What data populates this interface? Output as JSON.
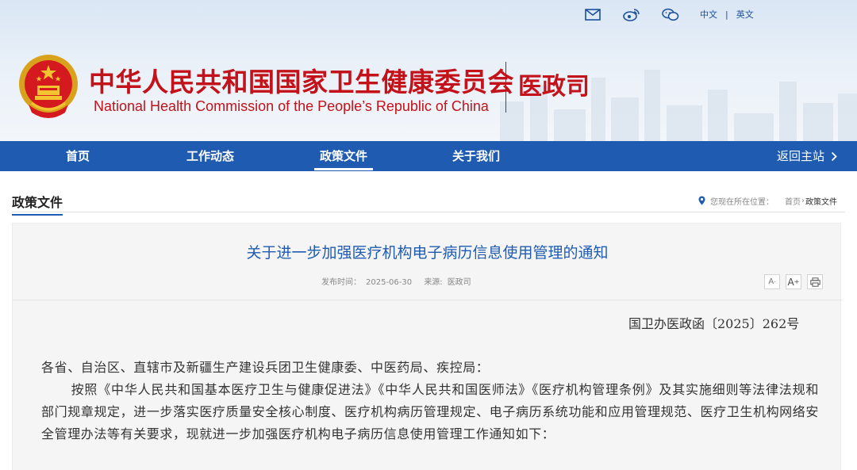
{
  "header": {
    "site_name_cn": "中华人民共和国国家卫生健康委员会",
    "site_name_en": "National Health Commission of the People’s  Republic of China",
    "department": "医政司",
    "util_icons": [
      "mail-icon",
      "weibo-icon",
      "wechat-icon"
    ],
    "lang_zh": "中文",
    "lang_separator": "|",
    "lang_en": "英文",
    "brand_color": "#c3121a"
  },
  "nav": {
    "items": [
      {
        "label": "首页"
      },
      {
        "label": "工作动态"
      },
      {
        "label": "政策文件",
        "active": true
      },
      {
        "label": "关于我们"
      }
    ],
    "return_label": "返回主站",
    "bg_color": "#1f5bb0"
  },
  "section": {
    "title": "政策文件",
    "breadcrumb": {
      "prefix": "您现在所在位置：",
      "home": "首页",
      "separator": "›",
      "current": "政策文件"
    }
  },
  "article": {
    "title": "关于进一步加强医疗机构电子病历信息使用管理的通知",
    "publish_label": "发布时间：",
    "publish_date": "2025-06-30",
    "source_label": "来源:",
    "source": "医政司",
    "tools": {
      "font_smaller": "A",
      "font_larger": "A",
      "print_icon": "print-icon"
    },
    "doc_number": "国卫办医政函〔2025〕262号",
    "salutation": "各省、自治区、直辖市及新疆生产建设兵团卫生健康委、中医药局、疾控局：",
    "paragraph_1": "按照《中华人民共和国基本医疗卫生与健康促进法》《中华人民共和国医师法》《医疗机构管理条例》及其实施细则等法律法规和部门规章规定，进一步落实医疗质量安全核心制度、医疗机构病历管理规定、电子病历系统功能和应用管理规范、医疗卫生机构网络安全管理办法等有关要求，现就进一步加强医疗机构电子病历信息使用管理工作通知如下："
  }
}
